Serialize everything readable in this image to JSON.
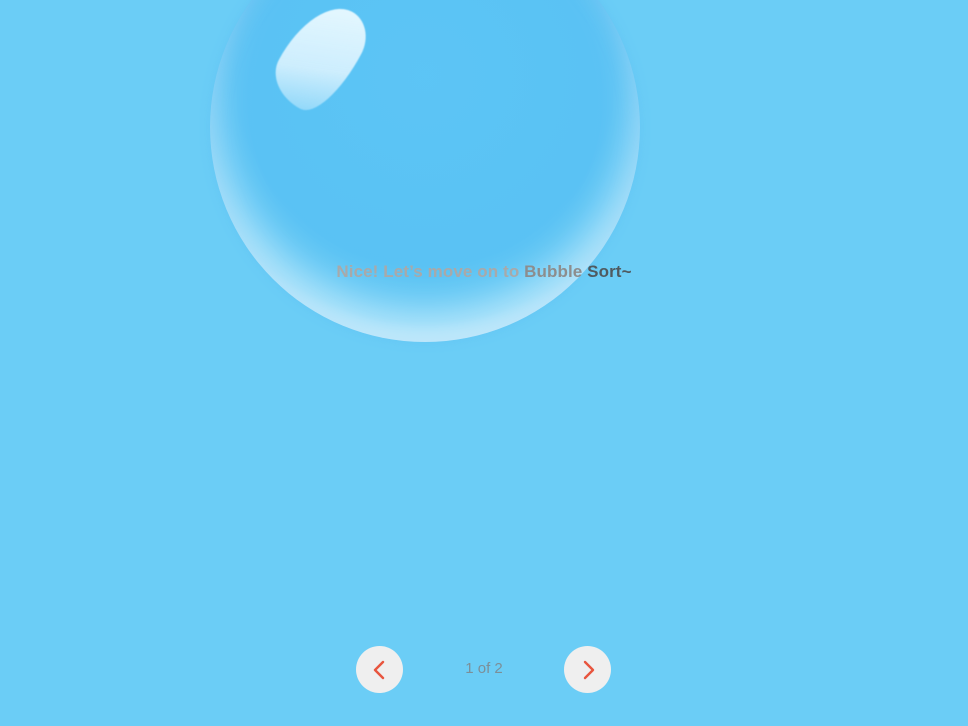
{
  "message": {
    "part1": "Nice! Let’s move on to ",
    "part2": "Bubble ",
    "part3": "Sort~"
  },
  "pager": {
    "indicator": "1 of 2",
    "prev_icon": "chevron-left-icon",
    "next_icon": "chevron-right-icon",
    "accent_color": "#e8553e"
  },
  "background_color": "#6bcdf6"
}
